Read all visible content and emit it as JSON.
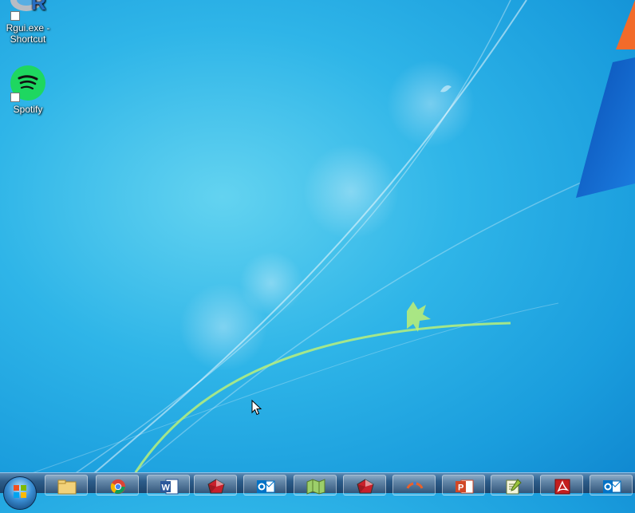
{
  "desktop": {
    "icons": [
      {
        "label": "Rgui.exe - Shortcut",
        "icon": "r-logo-icon"
      },
      {
        "label": "Spotify",
        "icon": "spotify-icon"
      }
    ]
  },
  "taskbar": {
    "start_button": "windows-start-orb",
    "items": [
      {
        "name": "windows-explorer",
        "icon": "folder-icon"
      },
      {
        "name": "google-chrome",
        "icon": "chrome-icon"
      },
      {
        "name": "microsoft-word",
        "icon": "word-icon"
      },
      {
        "name": "app-red-polyhedron-1",
        "icon": "red-polyhedron-icon"
      },
      {
        "name": "microsoft-outlook-1",
        "icon": "outlook-icon"
      },
      {
        "name": "map-app",
        "icon": "map-icon"
      },
      {
        "name": "app-red-polyhedron-2",
        "icon": "red-polyhedron-icon"
      },
      {
        "name": "orange-app",
        "icon": "orange-swirl-icon"
      },
      {
        "name": "microsoft-powerpoint",
        "icon": "powerpoint-icon"
      },
      {
        "name": "notepad-plus-plus",
        "icon": "notepad-icon"
      },
      {
        "name": "adobe-acrobat",
        "icon": "acrobat-icon"
      },
      {
        "name": "microsoft-outlook-2",
        "icon": "outlook-icon"
      }
    ]
  },
  "colors": {
    "wallpaper": "#1a9ddd",
    "taskbar": "#2d5d8a",
    "spotify_green": "#1ed760",
    "r_blue": "#276dc3",
    "accent_orange": "#f26b2a"
  }
}
